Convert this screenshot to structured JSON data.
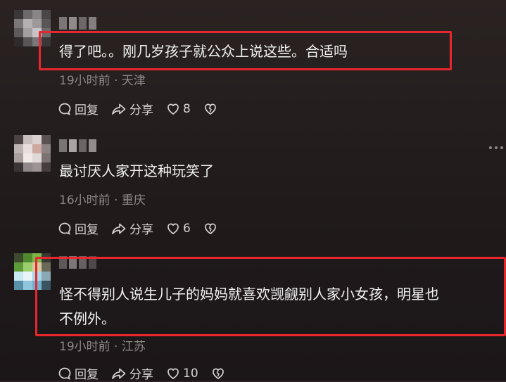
{
  "comments": [
    {
      "text": "得了吧。。刚几岁孩子就公众上说这些。合适吗",
      "time": "19小时前",
      "location": "天津",
      "reply_label": "回复",
      "share_label": "分享",
      "likes": "8"
    },
    {
      "text": "最讨厌人家开这种玩笑了",
      "time": "16小时前",
      "location": "重庆",
      "reply_label": "回复",
      "share_label": "分享",
      "likes": "6"
    },
    {
      "text_line1": "怪不得别人说生儿子的妈妈就喜欢觊觎别人家小女孩，明星也",
      "text_line2": "不例外。",
      "time": "19小时前",
      "location": "江苏",
      "reply_label": "回复",
      "share_label": "分享",
      "likes": "10"
    }
  ],
  "meta_separator": "·",
  "colors": {
    "highlight": "#e8262d",
    "meta_text": "#8e8889",
    "background": "#221c1d"
  },
  "icons": [
    "reply-bubble-icon",
    "share-arrow-icon",
    "heart-icon",
    "broken-heart-icon",
    "more-dots-icon"
  ]
}
